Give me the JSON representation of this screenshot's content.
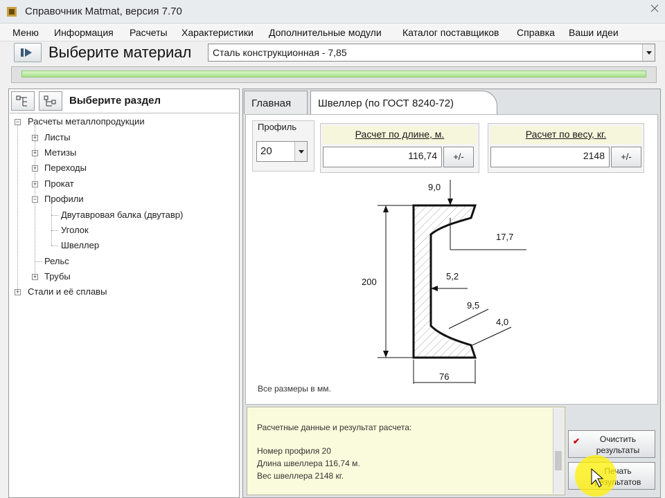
{
  "window": {
    "title": "Справочник Matmat, версия 7.70"
  },
  "menu": [
    "Меню",
    "Информация",
    "Расчеты",
    "Характеристики",
    "Дополнительные модули",
    "Каталог поставщиков",
    "Справка",
    "Ваши идеи"
  ],
  "material": {
    "label": "Выберите материал",
    "value": "Сталь конструкционная - 7,85"
  },
  "progress": {
    "fraction": 1.0
  },
  "sidebar": {
    "title": "Выберите раздел",
    "tree": [
      {
        "label": "Расчеты металлопродукции",
        "box": "−"
      },
      {
        "label": "Листы",
        "box": "+"
      },
      {
        "label": "Метизы",
        "box": "+"
      },
      {
        "label": "Переходы",
        "box": "+"
      },
      {
        "label": "Прокат",
        "box": "+"
      },
      {
        "label": "Профили",
        "box": "−"
      },
      {
        "label": "Двутавровая балка (двутавр)",
        "box": ""
      },
      {
        "label": "Уголок",
        "box": ""
      },
      {
        "label": "Швеллер",
        "box": ""
      },
      {
        "label": "Рельс",
        "box": ""
      },
      {
        "label": "Трубы",
        "box": "+"
      },
      {
        "label": "Стали и её сплавы",
        "box": "+"
      }
    ]
  },
  "tabs": [
    {
      "label": "Главная"
    },
    {
      "label": "Швеллер (по ГОСТ 8240-72)"
    }
  ],
  "profile": {
    "label": "Профиль",
    "value": "20"
  },
  "by_length": {
    "title": "Расчет по длине, м.",
    "value": "116,74",
    "button": "+/-"
  },
  "by_weight": {
    "title": "Расчет по весу, кг.",
    "value": "2148",
    "button": "+/-"
  },
  "drawing": {
    "dims": {
      "top": "9,0",
      "flange": "17,7",
      "web": "5,2",
      "height": "200",
      "r1": "9,5",
      "r2": "4,0",
      "width": "76"
    },
    "note": "Все размеры в мм."
  },
  "results": {
    "header": "Расчетные данные и результат расчета:",
    "lines": [
      "Номер профиля 20",
      "Длина швеллера 116,74 м.",
      "Вес швеллера 2148 кг."
    ]
  },
  "actions": {
    "clear": "Очистить результаты",
    "print": "Печать результатов"
  }
}
